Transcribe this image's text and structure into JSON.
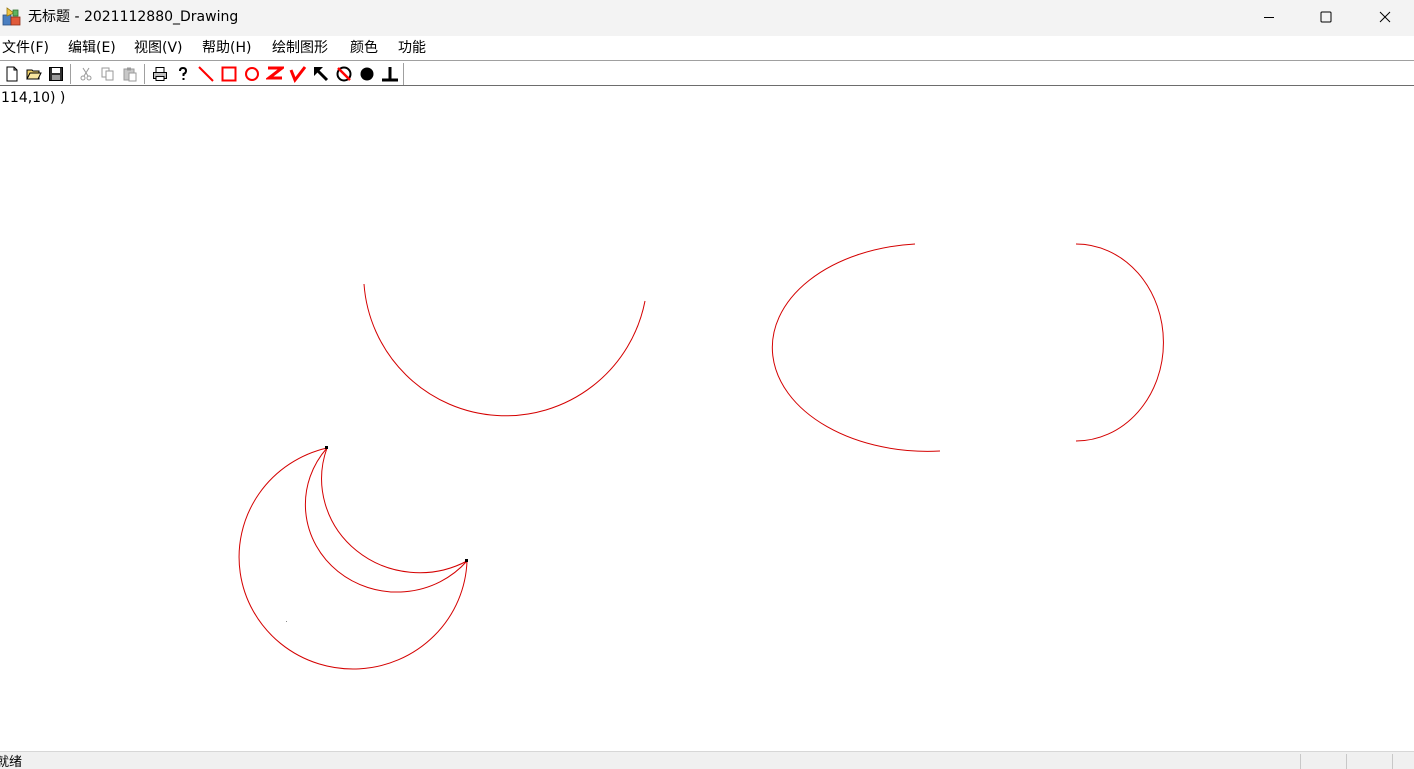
{
  "window": {
    "title": "无标题 - 2021112880_Drawing"
  },
  "menu": [
    "文件(F)",
    "编辑(E)",
    "视图(V)",
    "帮助(H)",
    "绘制图形",
    "颜色",
    "功能"
  ],
  "toolbar": {
    "icons": [
      "new-file-icon",
      "open-folder-icon",
      "save-icon",
      "cut-icon",
      "copy-icon",
      "paste-icon",
      "print-icon",
      "help-icon",
      "line-tool-icon",
      "rectangle-tool-icon",
      "ellipse-tool-icon",
      "z-shape-tool-icon",
      "check-shape-tool-icon",
      "arrow-tool-icon",
      "no-fill-tool-icon",
      "filled-circle-tool-icon",
      "perpendicular-tool-icon"
    ]
  },
  "canvas": {
    "coordinate_text": "114,10) )",
    "stroke_color": "#d40000"
  },
  "status": {
    "text": "就绪"
  }
}
